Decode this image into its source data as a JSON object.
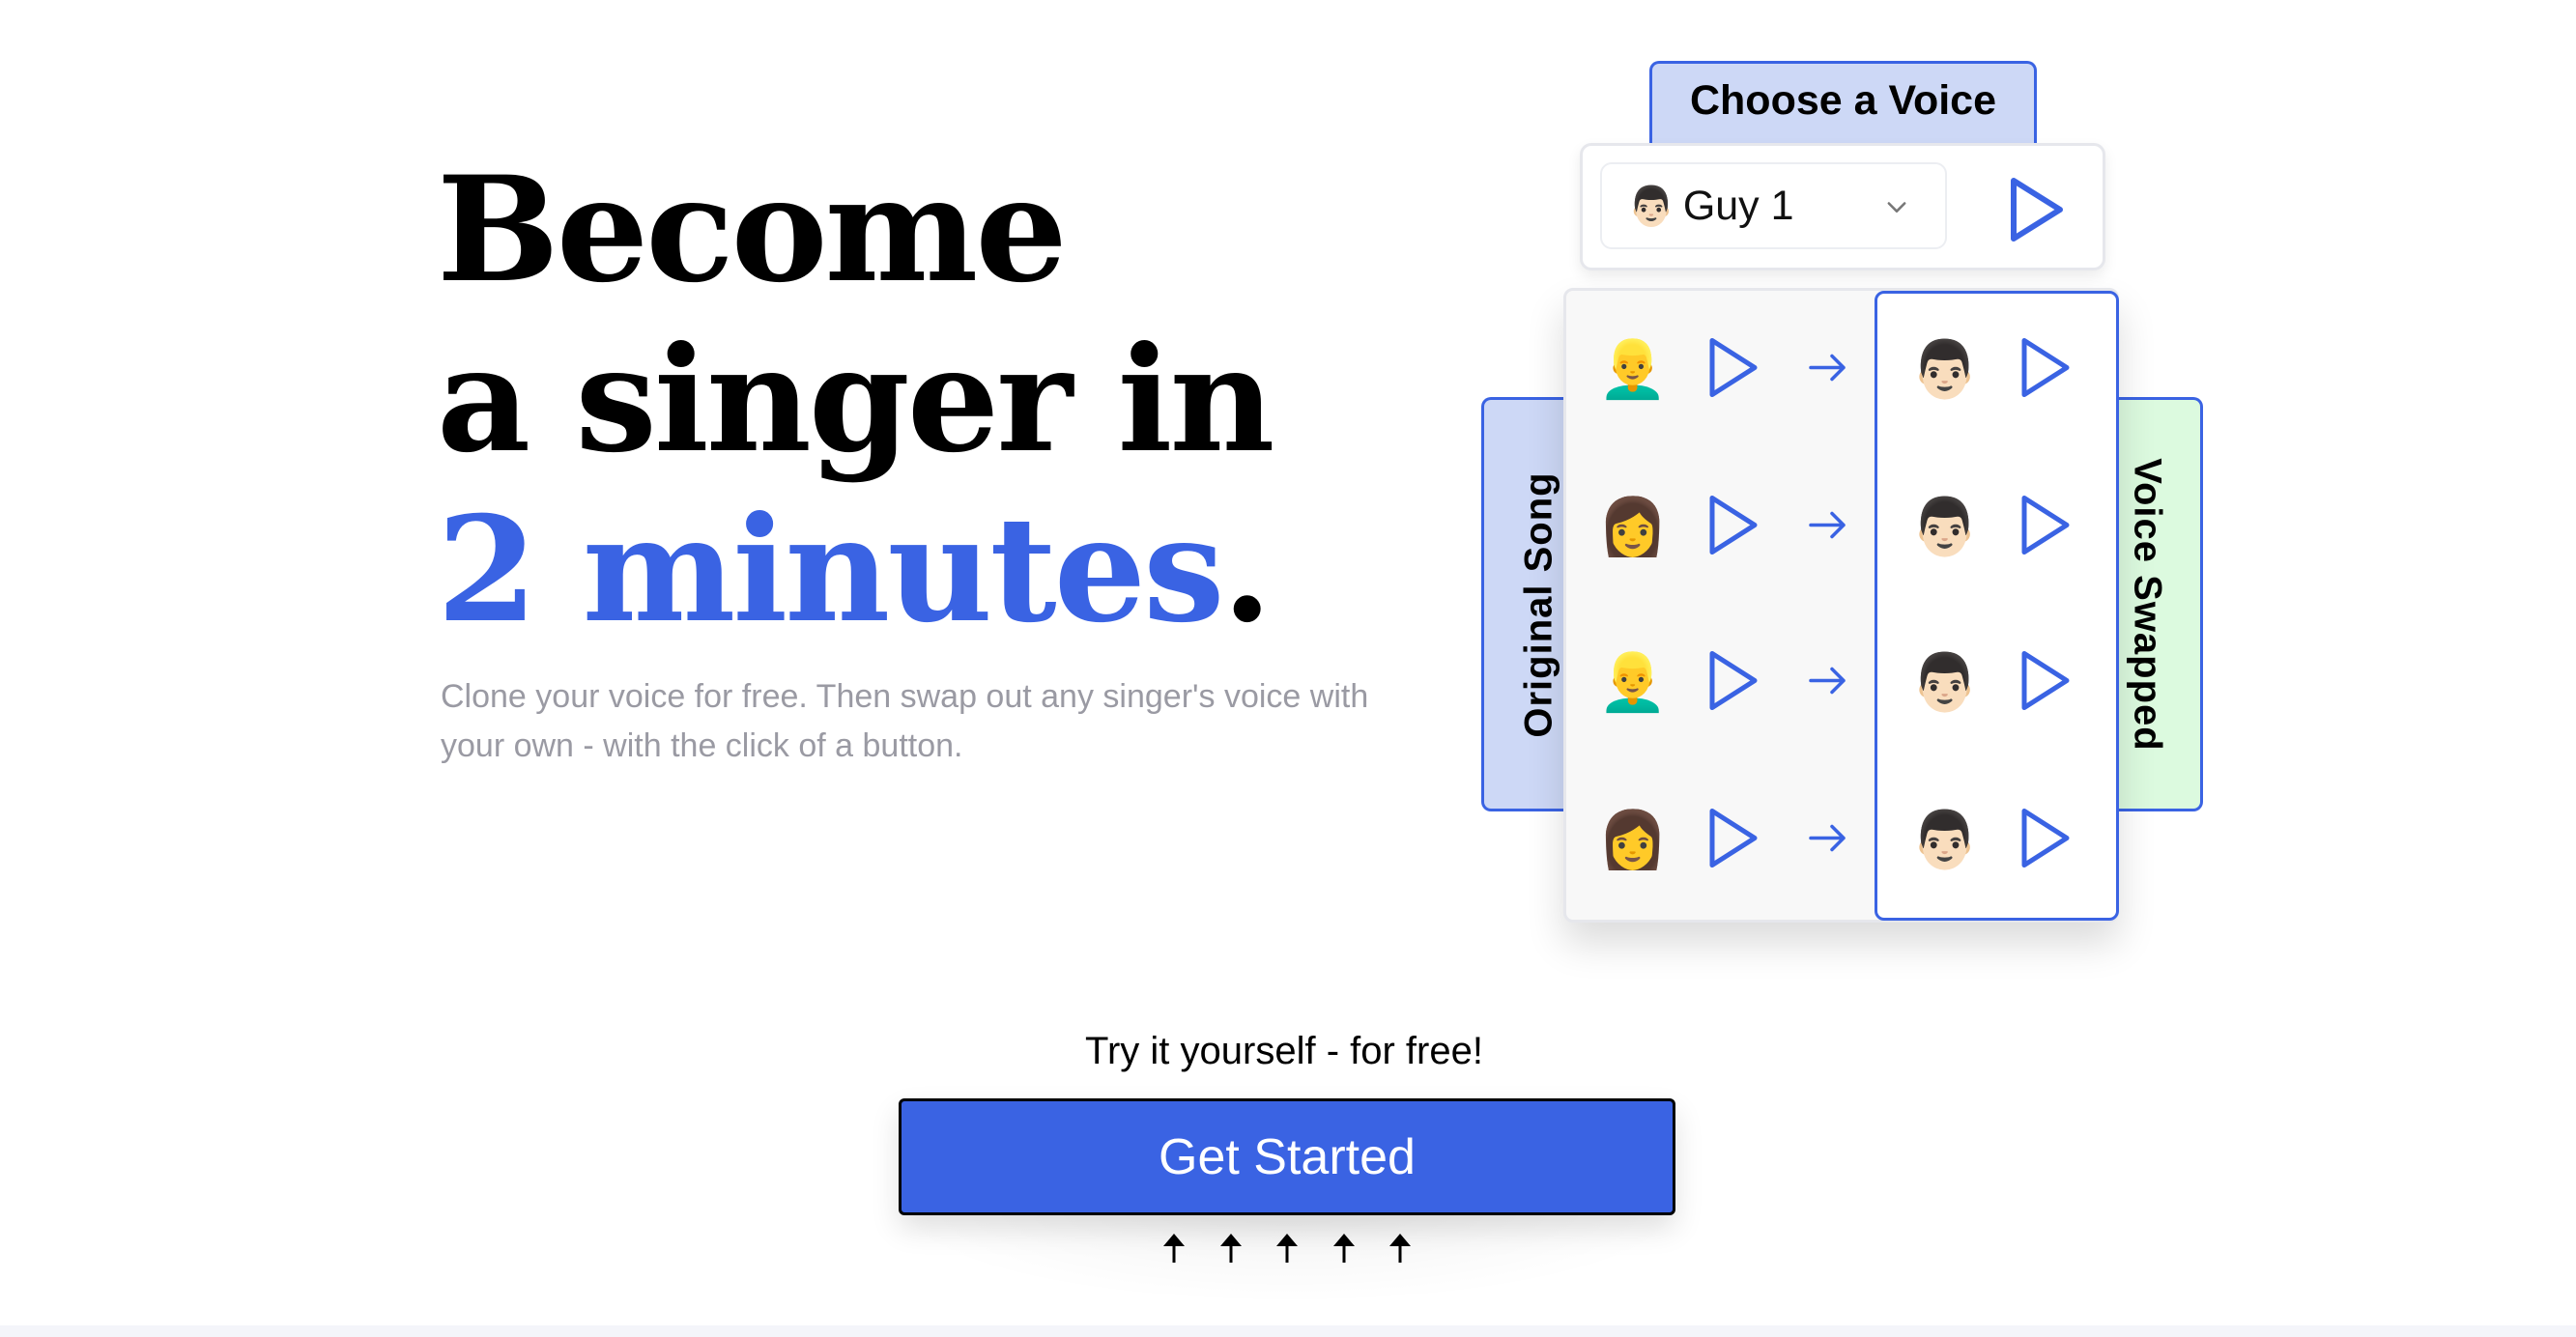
{
  "hero": {
    "headline_line1": "Become",
    "headline_line2": "a singer in",
    "headline_accent": "2 minutes",
    "headline_period": ".",
    "subtitle": "Clone your voice for free. Then swap out any singer's voice with your own - with the click of a button."
  },
  "voice_picker": {
    "title": "Choose a Voice",
    "selected_emoji": "👨🏻",
    "selected_label": "Guy 1",
    "dropdown_icon": "chevron-down-icon",
    "play_icon": "play-icon"
  },
  "demo_grid": {
    "left_label": "Original Song",
    "right_label": "Voice Swapped",
    "rows": [
      {
        "original_emoji": "👱‍♂️",
        "swapped_emoji": "👨🏻"
      },
      {
        "original_emoji": "👩",
        "swapped_emoji": "👨🏻"
      },
      {
        "original_emoji": "👱‍♂️",
        "swapped_emoji": "👨🏻"
      },
      {
        "original_emoji": "👩",
        "swapped_emoji": "👨🏻"
      }
    ]
  },
  "cta": {
    "prompt": "Try it yourself - for free!",
    "button_label": "Get Started",
    "arrow_count": 5
  },
  "colors": {
    "accent": "#3a63e3",
    "tab_blue_bg": "#cdd8f6",
    "tab_green_bg": "#dcfadf",
    "subtitle_gray": "#9a9aa3"
  }
}
